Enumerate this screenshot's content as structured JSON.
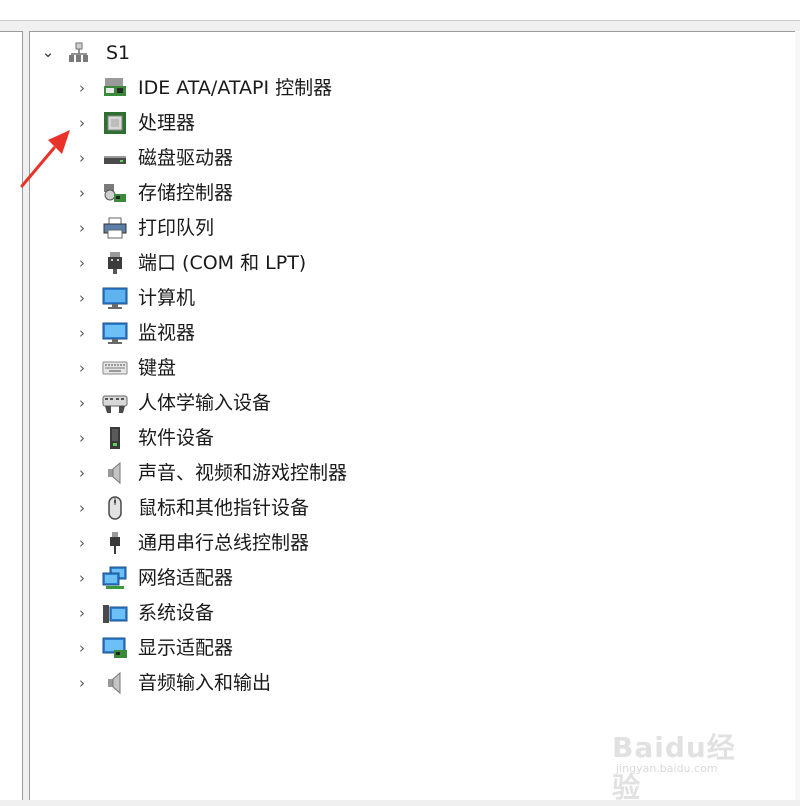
{
  "tree": {
    "root": {
      "label": "S1",
      "icon": "computer-network-icon",
      "expanded": true
    },
    "items": [
      {
        "label": "IDE ATA/ATAPI 控制器",
        "icon": "ide-controller-icon"
      },
      {
        "label": "处理器",
        "icon": "processor-chip-icon"
      },
      {
        "label": "磁盘驱动器",
        "icon": "disk-drive-icon"
      },
      {
        "label": "存储控制器",
        "icon": "storage-controller-icon"
      },
      {
        "label": "打印队列",
        "icon": "printer-icon"
      },
      {
        "label": "端口 (COM 和 LPT)",
        "icon": "port-connector-icon"
      },
      {
        "label": "计算机",
        "icon": "computer-monitor-icon"
      },
      {
        "label": "监视器",
        "icon": "monitor-icon"
      },
      {
        "label": "键盘",
        "icon": "keyboard-icon"
      },
      {
        "label": "人体学输入设备",
        "icon": "hid-gamepad-icon"
      },
      {
        "label": "软件设备",
        "icon": "software-device-icon"
      },
      {
        "label": "声音、视频和游戏控制器",
        "icon": "speaker-icon"
      },
      {
        "label": "鼠标和其他指针设备",
        "icon": "mouse-icon"
      },
      {
        "label": "通用串行总线控制器",
        "icon": "usb-plug-icon"
      },
      {
        "label": "网络适配器",
        "icon": "network-adapter-icon"
      },
      {
        "label": "系统设备",
        "icon": "system-device-icon"
      },
      {
        "label": "显示适配器",
        "icon": "display-adapter-icon"
      },
      {
        "label": "音频输入和输出",
        "icon": "audio-speaker-icon"
      }
    ]
  },
  "annotation": {
    "arrow_color": "#e8322a"
  },
  "watermark": {
    "brand": "Baidu经验",
    "url": "jingyan.baidu.com"
  }
}
